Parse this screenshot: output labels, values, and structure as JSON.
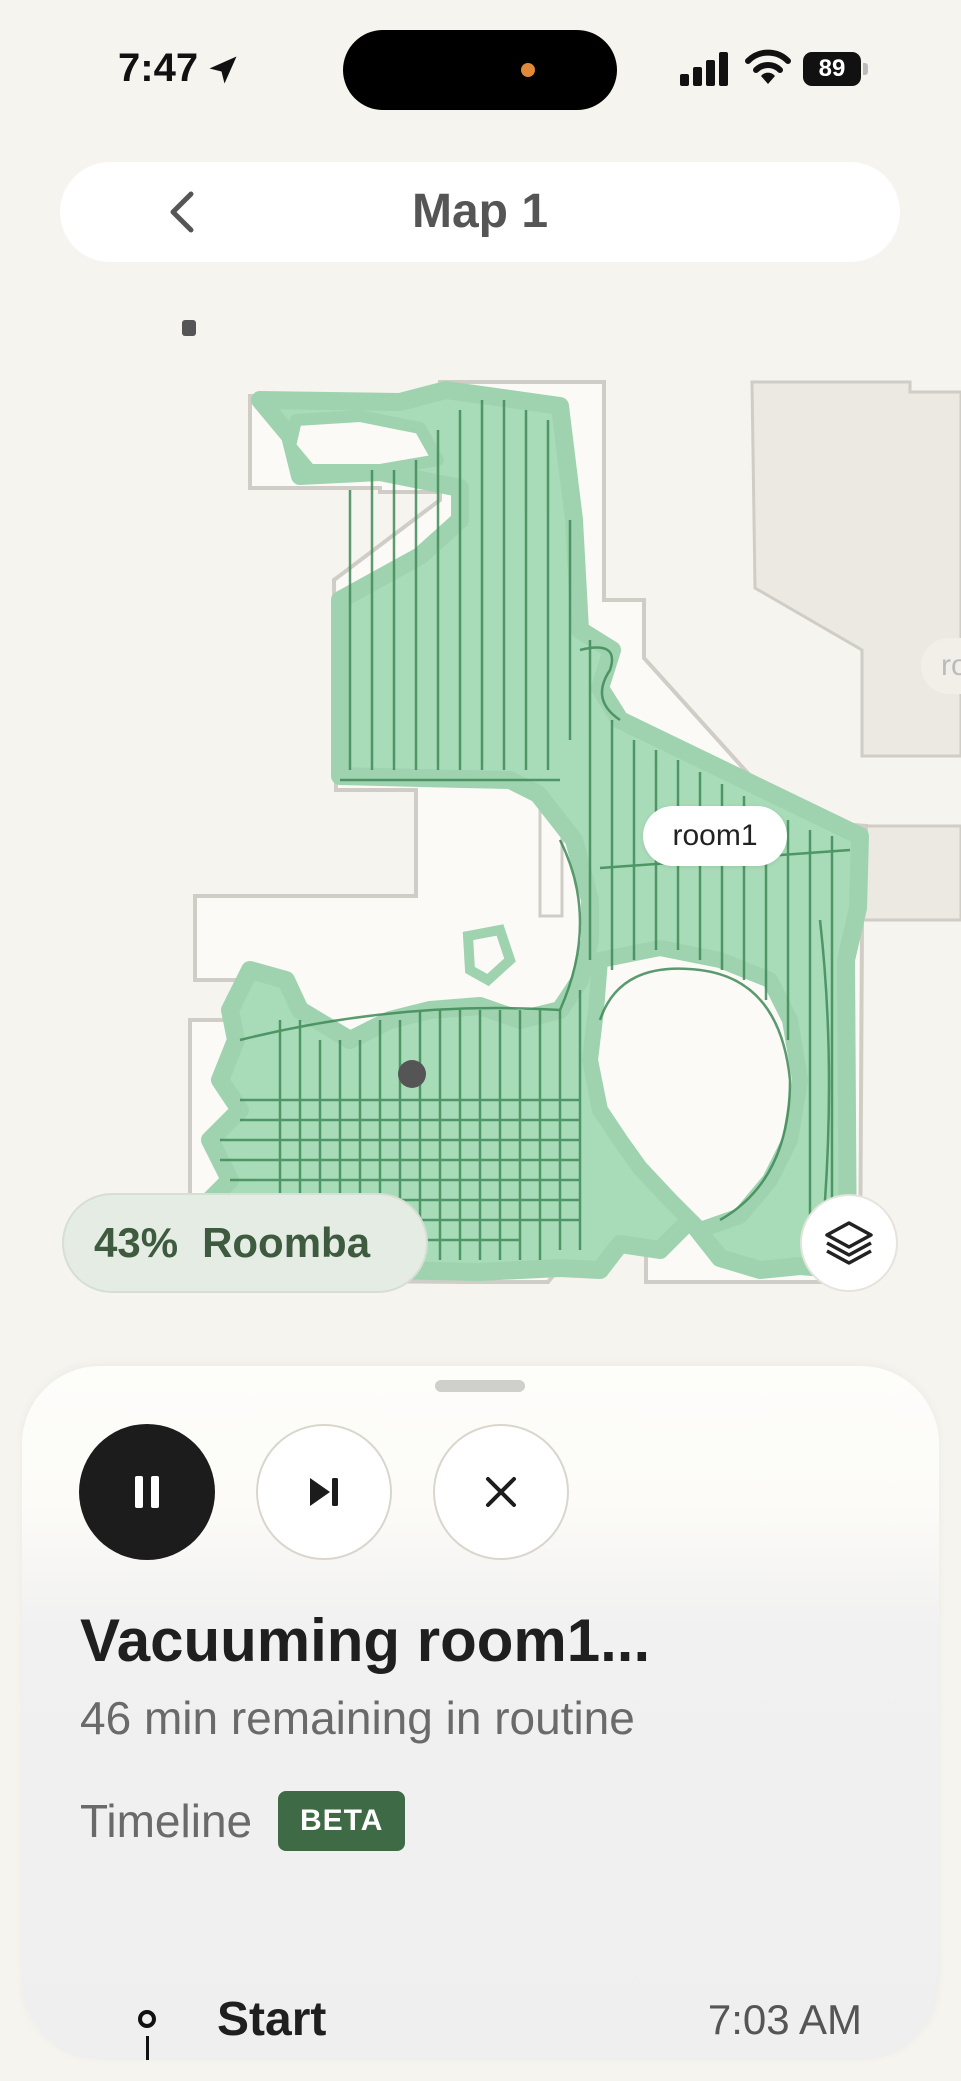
{
  "status_bar": {
    "time": "7:47",
    "battery": "89",
    "accent": "#e0893a"
  },
  "header": {
    "title": "Map 1",
    "back_icon": "chevron-left-icon"
  },
  "map": {
    "room_label": "room1",
    "room_label_partial": "ro",
    "coverage_color": "#9fd3af",
    "path_color": "#3f8a58"
  },
  "robot": {
    "progress": "43%",
    "name": "Roomba"
  },
  "sheet": {
    "controls": [
      {
        "name": "pause",
        "icon": "pause-icon"
      },
      {
        "name": "skip",
        "icon": "skip-next-icon"
      },
      {
        "name": "stop",
        "icon": "close-icon"
      }
    ],
    "status_title": "Vacuuming room1...",
    "status_sub": "46 min remaining in routine",
    "timeline_label": "Timeline",
    "beta_badge": "BETA",
    "timeline_events": [
      {
        "label": "Start",
        "time": "7:03 AM"
      }
    ]
  }
}
